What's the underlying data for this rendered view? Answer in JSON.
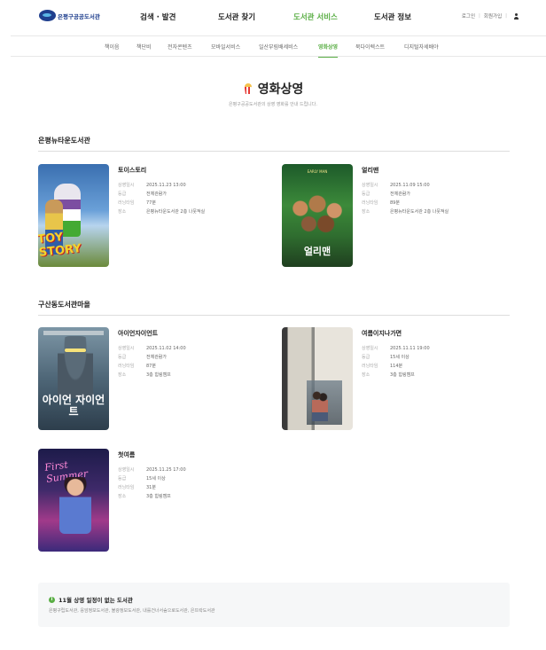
{
  "header": {
    "logo_text": "은평구공공도서관",
    "nav": [
      {
        "label": "검색 · 발견",
        "active": false
      },
      {
        "label": "도서관 찾기",
        "active": false
      },
      {
        "label": "도서관 서비스",
        "active": true
      },
      {
        "label": "도서관 정보",
        "active": false
      }
    ],
    "util": {
      "login": "로그인",
      "join": "회원가입"
    }
  },
  "subnav": [
    {
      "label": "책이음",
      "active": false
    },
    {
      "label": "책단비",
      "active": false
    },
    {
      "label": "전자콘텐츠",
      "active": false
    },
    {
      "label": "모바일서비스",
      "active": false
    },
    {
      "label": "일산부림배세비스",
      "active": false
    },
    {
      "label": "영화상영",
      "active": true
    },
    {
      "label": "북다이렉스트",
      "active": false
    },
    {
      "label": "디지털자세배야",
      "active": false
    }
  ],
  "page": {
    "title": "영화상영",
    "subtitle": "은평구공공도서관의 상영 영화를 안내 드립니다."
  },
  "labels": {
    "date": "상영일시",
    "rating": "등급",
    "runtime": "러닝타임",
    "place": "장소"
  },
  "sections": [
    {
      "name": "은평뉴타운도서관",
      "movies": [
        {
          "title": "토이스토리",
          "date": "2025.11.23 13:00",
          "rating": "전체관람가",
          "runtime": "77분",
          "place": "은평뉴타운도서관 2층 나뭇적실",
          "poster_text": "TOY STORY"
        },
        {
          "title": "얼리맨",
          "date": "2025.11.09 15:00",
          "rating": "전체관람가",
          "runtime": "89분",
          "place": "은평뉴타운도서관 2층 나뭇적실",
          "poster_text": "얼리맨"
        }
      ]
    },
    {
      "name": "구산동도서관마을",
      "movies": [
        {
          "title": "아이언자이언트",
          "date": "2025.11.02 14:00",
          "rating": "전체관람가",
          "runtime": "87분",
          "place": "3층 힘링캠프",
          "poster_text": "아이언 자이언트"
        },
        {
          "title": "여름이지나가면",
          "date": "2025.11.11 19:00",
          "rating": "15세 이상",
          "runtime": "114분",
          "place": "3층 힘링캠프",
          "poster_text": ""
        },
        {
          "title": "첫여름",
          "date": "2025.11.25 17:00",
          "rating": "15세 이상",
          "runtime": "31분",
          "place": "3층 힘링캠프",
          "poster_text": "First Summer"
        }
      ]
    }
  ],
  "notice": {
    "title": "11월 상영 일정이 없는 도서관",
    "text": "은평구립도서관, 응암정보도서관, 불광정보도서관, 내를건너서숲으로도서관, 은뜨락도서관"
  },
  "colors": {
    "accent": "#5aae45",
    "brand": "#1f3f8e"
  }
}
